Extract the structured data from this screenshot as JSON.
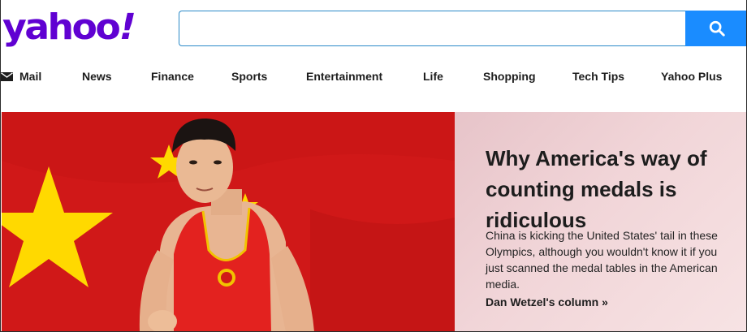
{
  "header": {
    "logo_text": "yahoo",
    "logo_bang": "!",
    "search": {
      "value": "",
      "placeholder": ""
    },
    "search_icon": "search-icon"
  },
  "nav": {
    "items": [
      {
        "label": "Mail",
        "icon": "mail-icon"
      },
      {
        "label": "News"
      },
      {
        "label": "Finance"
      },
      {
        "label": "Sports"
      },
      {
        "label": "Entertainment"
      },
      {
        "label": "Life"
      },
      {
        "label": "Shopping"
      },
      {
        "label": "Tech Tips"
      },
      {
        "label": "Yahoo Plus"
      }
    ]
  },
  "hero": {
    "headline": "Why America's way of counting medals is ridiculous",
    "summary": "China is kicking the United States' tail in these Olympics, although you wouldn't know it if you just scanned the medal tables in the American media.",
    "link": "Dan Wetzel's column »"
  },
  "colors": {
    "brand": "#6001d2",
    "search_button": "#1a8cff",
    "flag_red": "#d21a1a",
    "flag_star": "#ffde00"
  }
}
